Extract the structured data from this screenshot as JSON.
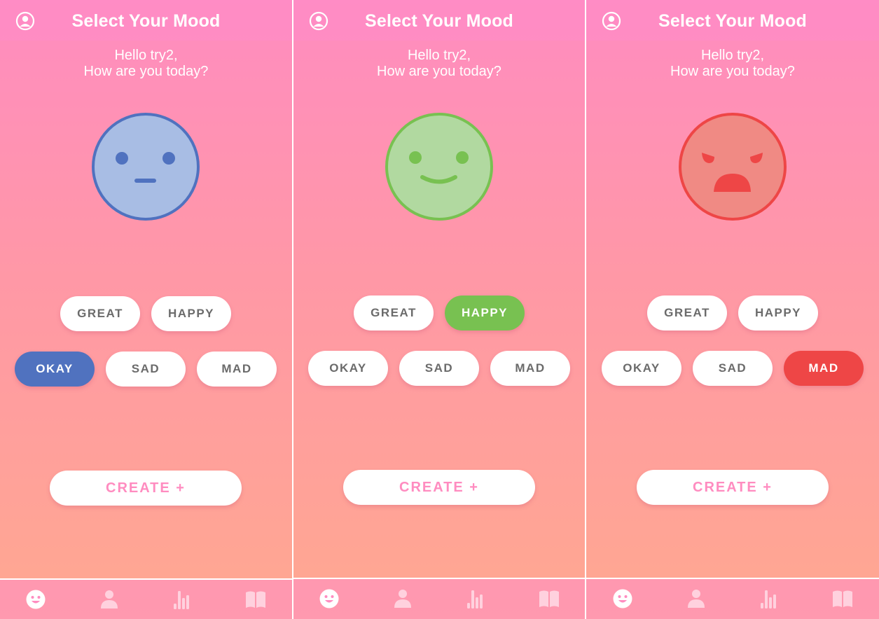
{
  "screens": [
    {
      "title": "Select Your Mood",
      "greeting_line1": "Hello try2,",
      "greeting_line2": "How are you today?",
      "face": "okay-face-icon",
      "face_fill": "#a8bde4",
      "face_stroke": "#5072bf",
      "moods": [
        {
          "label": "GREAT",
          "selected": false
        },
        {
          "label": "HAPPY",
          "selected": false
        },
        {
          "label": "OKAY",
          "selected": true,
          "color": "#5072bf"
        },
        {
          "label": "SAD",
          "selected": false
        },
        {
          "label": "MAD",
          "selected": false
        }
      ],
      "create_label": "CREATE +"
    },
    {
      "title": "Select Your Mood",
      "greeting_line1": "Hello try2,",
      "greeting_line2": "How are you today?",
      "face": "happy-face-icon",
      "face_fill": "#b1d9a0",
      "face_stroke": "#78c151",
      "moods": [
        {
          "label": "GREAT",
          "selected": false
        },
        {
          "label": "HAPPY",
          "selected": true,
          "color": "#78c151"
        },
        {
          "label": "OKAY",
          "selected": false
        },
        {
          "label": "SAD",
          "selected": false
        },
        {
          "label": "MAD",
          "selected": false
        }
      ],
      "create_label": "CREATE +"
    },
    {
      "title": "Select Your Mood",
      "greeting_line1": "Hello try2,",
      "greeting_line2": "How are you today?",
      "face": "mad-face-icon",
      "face_fill": "#f08a84",
      "face_stroke": "#ee4646",
      "moods": [
        {
          "label": "GREAT",
          "selected": false
        },
        {
          "label": "HAPPY",
          "selected": false
        },
        {
          "label": "OKAY",
          "selected": false
        },
        {
          "label": "SAD",
          "selected": false
        },
        {
          "label": "MAD",
          "selected": true,
          "color": "#ee4646"
        }
      ],
      "create_label": "CREATE +"
    }
  ],
  "nav_icons": [
    "mood-face-icon",
    "profile-person-icon",
    "stats-bars-icon",
    "journal-book-icon"
  ],
  "colors": {
    "accent_pink": "#ff8cc0",
    "button_text": "#6b6b6b"
  }
}
